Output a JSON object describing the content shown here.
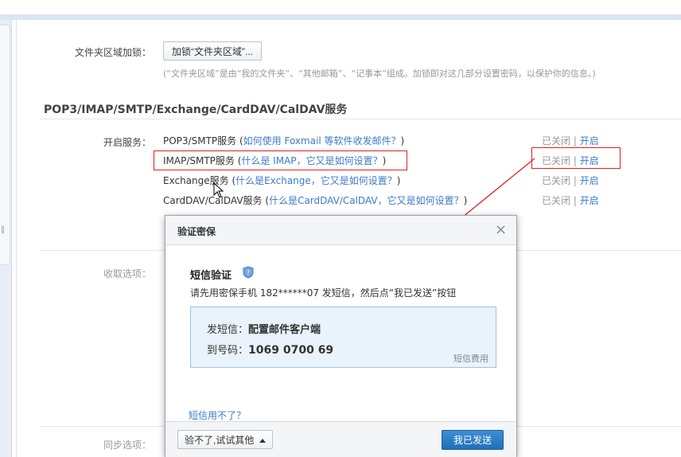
{
  "folder_lock": {
    "label": "文件夹区域加锁：",
    "button": "加锁“文件夹区域”...",
    "hint": "(“文件夹区域”是由“我的文件夹”、“其他邮箱”、“记事本”组成。加锁即对这几部分设置密码，以保护你的信息。)"
  },
  "section_title": "POP3/IMAP/SMTP/Exchange/CardDAV/CalDAV服务",
  "services": {
    "label": "开启服务：",
    "items": [
      {
        "name": "POP3/SMTP服务",
        "open": "(",
        "help": "如何使用 Foxmail 等软件收发邮件？",
        "close": ")",
        "status": "已关闭",
        "sep": "|",
        "action": "开启"
      },
      {
        "name": "IMAP/SMTP服务",
        "open": "(",
        "help": "什么是 IMAP，它又是如何设置？",
        "close": ")",
        "status": "已关闭",
        "sep": "|",
        "action": "开启"
      },
      {
        "name": "Exchange服务",
        "open": "(",
        "help": "什么是Exchange，它又是如何设置？",
        "close": ")",
        "status": "已关闭",
        "sep": "|",
        "action": "开启"
      },
      {
        "name": "CardDAV/CalDAV服务",
        "open": "(",
        "help": "什么是CardDAV/CalDAV，它又是如何设置？",
        "close": ")",
        "status": "已关闭",
        "sep": "|",
        "action": "开启"
      }
    ]
  },
  "receive_label": "收取选项：",
  "sync_label": "同步选项：",
  "sidebar_tick": "‖",
  "dialog": {
    "title": "验证密保",
    "close": "×",
    "heading": "短信验证",
    "instruction": "请先用密保手机 182******07 发短信，然后点“我已发送”按钮",
    "sms_label": "发短信：",
    "sms_content": "配置邮件客户端",
    "to_label": "到号码：",
    "to_number": "1069 0700 69",
    "fee": "短信费用",
    "sms_unavailable": "短信用不了？",
    "try_other": "验不了,试试其他",
    "sent": "我已发送"
  },
  "colors": {
    "link": "#3a7bc8",
    "highlight": "#e02020",
    "primary": "#2a78c2"
  }
}
